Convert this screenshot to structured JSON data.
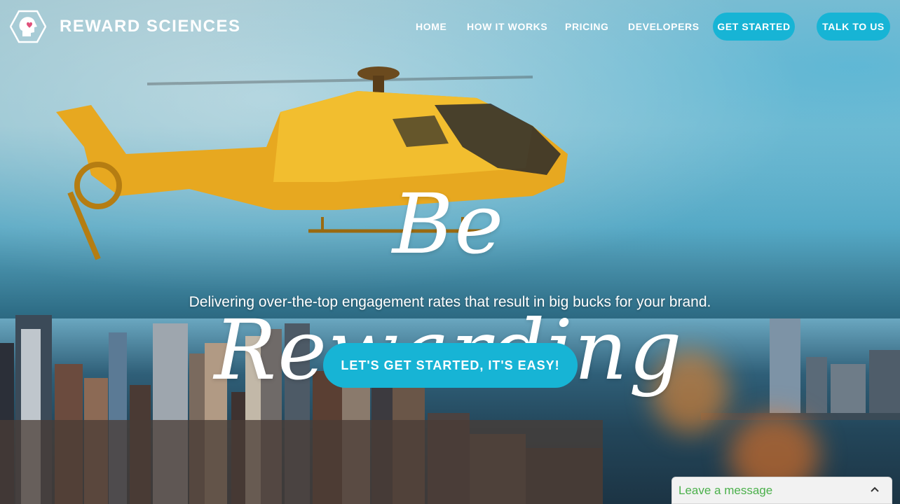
{
  "brand": {
    "name": "REWARD SCIENCES",
    "logo_icon": "head-with-heart-icon",
    "colors": {
      "accent": "#17b4d5",
      "text": "#ffffff",
      "chat_green": "#4bb04b"
    }
  },
  "nav": {
    "links": [
      {
        "label": "HOME"
      },
      {
        "label": "HOW IT WORKS"
      },
      {
        "label": "PRICING"
      },
      {
        "label": "DEVELOPERS"
      }
    ],
    "get_started_label": "GET STARTED",
    "talk_label": "TALK TO US"
  },
  "hero": {
    "headline": "Be Rewarding",
    "subline": "Delivering over-the-top engagement rates that result in big bucks for your brand.",
    "cta_label": "LET'S GET STARTED, IT'S EASY!"
  },
  "chat_widget": {
    "label": "Leave a message",
    "icon": "chevron-up-icon"
  }
}
